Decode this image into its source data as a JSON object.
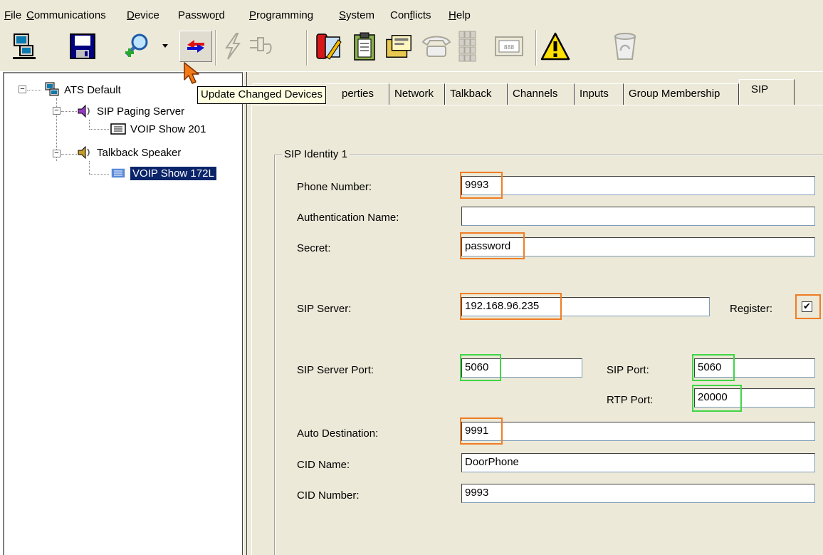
{
  "menu": {
    "items": [
      "File",
      "Communications",
      "Device",
      "Password",
      "Programming",
      "System",
      "Conflicts",
      "Help"
    ]
  },
  "toolbar": {
    "buttons": [
      "network-computer-icon",
      "save-disk-icon",
      "search-add-icon",
      "dropdown-arrow-icon",
      "update-devices-icon",
      "lightning-icon",
      "plug-icon",
      "phone-edit-icon",
      "clipboard-icon",
      "folder-cards-icon",
      "telephone-icon",
      "keypad-icon",
      "display-panel-icon",
      "warning-icon",
      "recycle-bin-icon"
    ],
    "tooltip": "Update Changed Devices"
  },
  "tree": {
    "root": "ATS Default",
    "nodes": [
      {
        "label": "SIP Paging Server",
        "child": "VOIP Show 201"
      },
      {
        "label": "Talkback Speaker",
        "child": "VOIP Show 172L"
      }
    ],
    "selected": "VOIP Show 172L"
  },
  "tabs": {
    "labels": [
      "Properties",
      "Network",
      "Talkback",
      "Channels",
      "Inputs",
      "Group Membership",
      "SIP"
    ],
    "visible_partial": "perties",
    "active": "SIP"
  },
  "sip": {
    "group_title": "SIP Identity 1",
    "phone_number_label": "Phone Number:",
    "phone_number": "9993",
    "auth_name_label": "Authentication Name:",
    "auth_name": "",
    "secret_label": "Secret:",
    "secret": "password",
    "sip_server_label": "SIP Server:",
    "sip_server": "192.168.96.235",
    "register_label": "Register:",
    "register_checked": true,
    "register_mark": "✔",
    "sip_server_port_label": "SIP Server Port:",
    "sip_server_port": "5060",
    "sip_port_label": "SIP Port:",
    "sip_port": "5060",
    "rtp_port_label": "RTP Port:",
    "rtp_port": "20000",
    "auto_destination_label": "Auto Destination:",
    "auto_destination": "9991",
    "cid_name_label": "CID Name:",
    "cid_name": "DoorPhone",
    "cid_number_label": "CID Number:",
    "cid_number": "9993"
  },
  "colors": {
    "highlight_orange": "#f07d24",
    "highlight_green": "#3fd646",
    "selection": "#0a246a",
    "chrome": "#ece9d8"
  }
}
